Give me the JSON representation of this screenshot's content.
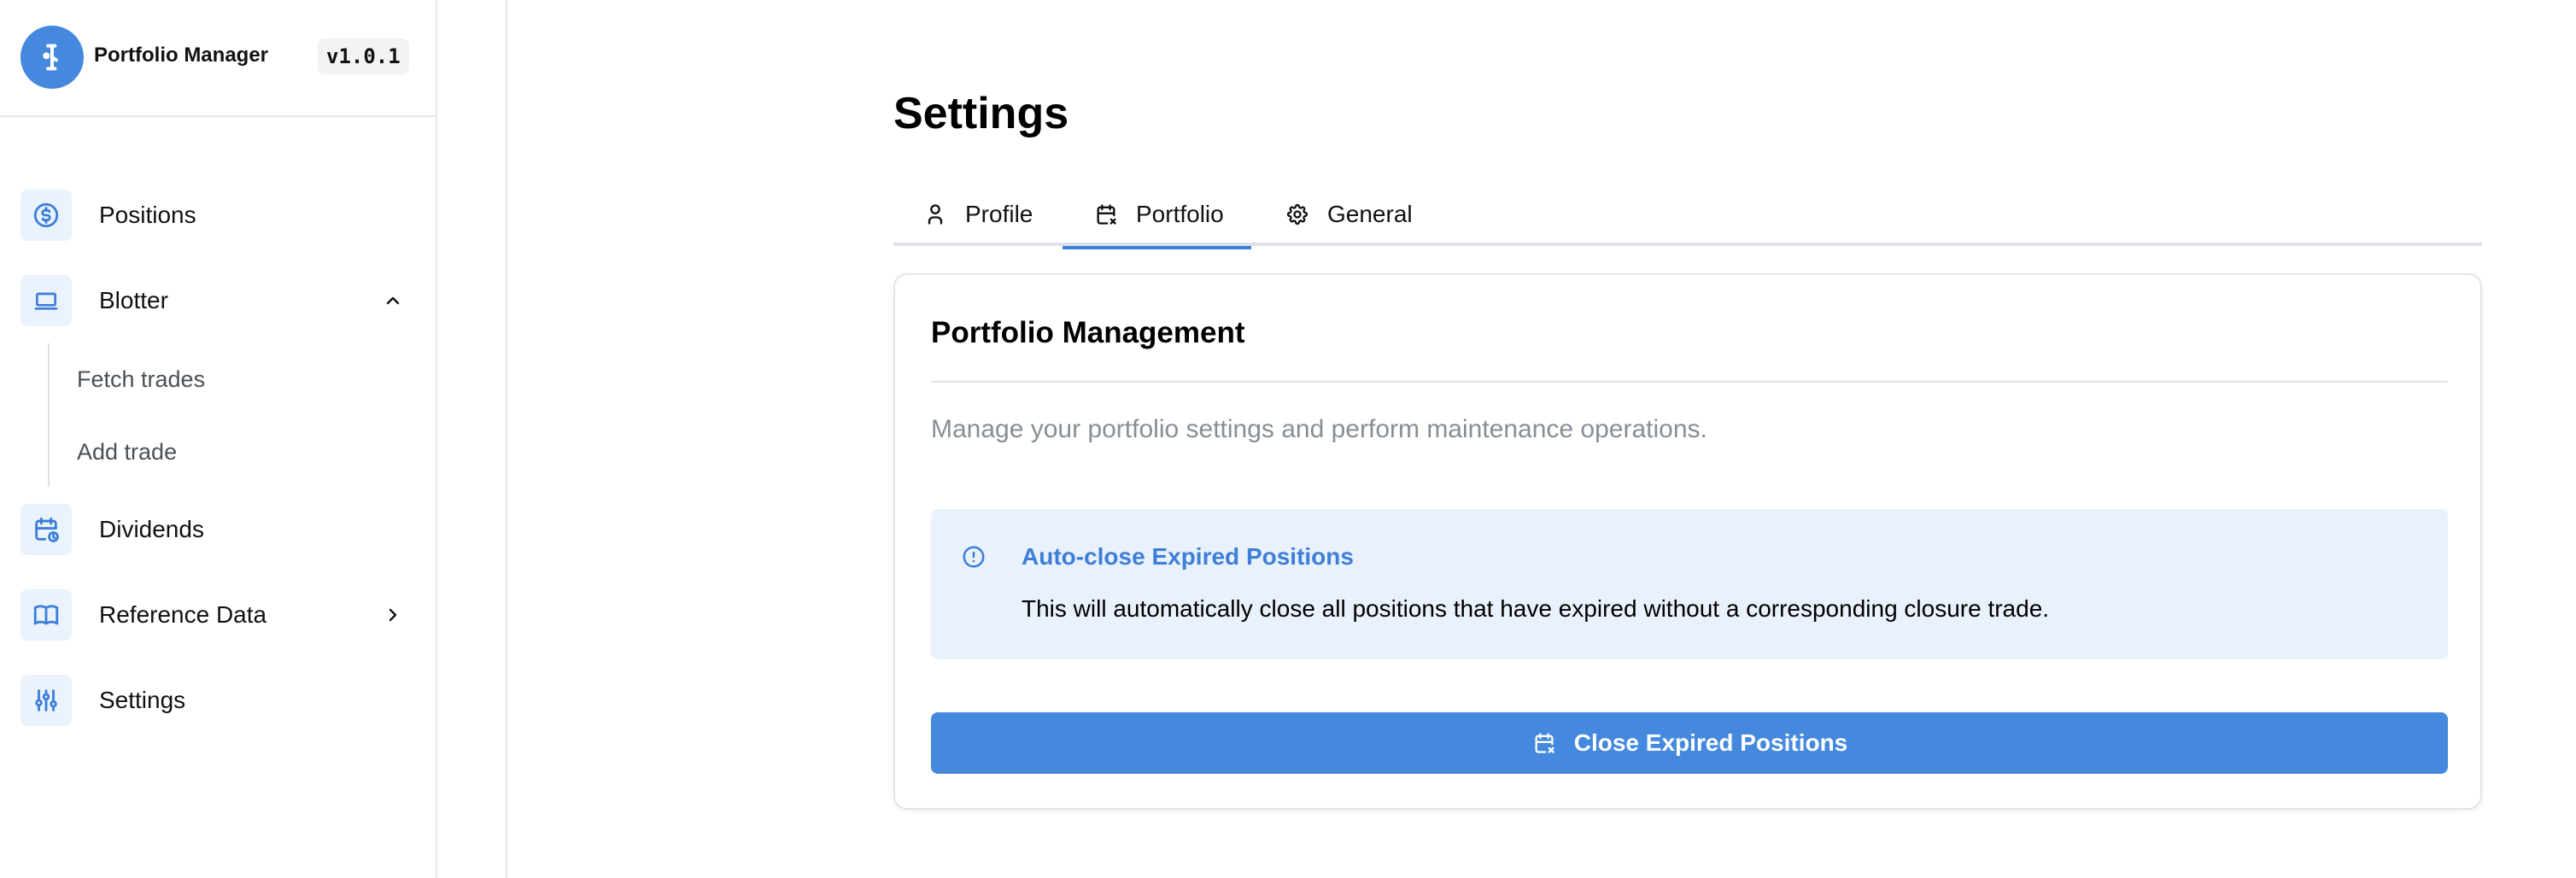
{
  "app": {
    "title": "Portfolio Manager",
    "version": "v1.0.1",
    "logo_icon": "flask-logo-icon",
    "accent_color": "#4589df"
  },
  "sidebar": {
    "items": [
      {
        "label": "Positions",
        "icon": "dollar-circle-icon"
      },
      {
        "label": "Blotter",
        "icon": "laptop-icon",
        "expanded": true,
        "children": [
          {
            "label": "Fetch trades"
          },
          {
            "label": "Add trade"
          }
        ]
      },
      {
        "label": "Dividends",
        "icon": "calendar-clock-icon"
      },
      {
        "label": "Reference Data",
        "icon": "book-open-icon",
        "expanded": false
      },
      {
        "label": "Settings",
        "icon": "sliders-icon"
      }
    ]
  },
  "main": {
    "title": "Settings",
    "tabs": [
      {
        "label": "Profile",
        "icon": "user-icon",
        "active": false
      },
      {
        "label": "Portfolio",
        "icon": "calendar-x-icon",
        "active": true
      },
      {
        "label": "General",
        "icon": "gear-icon",
        "active": false
      }
    ],
    "card": {
      "title": "Portfolio Management",
      "description": "Manage your portfolio settings and perform maintenance operations.",
      "alert": {
        "icon": "info-circle-icon",
        "title": "Auto-close Expired Positions",
        "text": "This will automatically close all positions that have expired without a corresponding closure trade."
      },
      "button": {
        "label": "Close Expired Positions",
        "icon": "calendar-x-icon"
      }
    }
  }
}
